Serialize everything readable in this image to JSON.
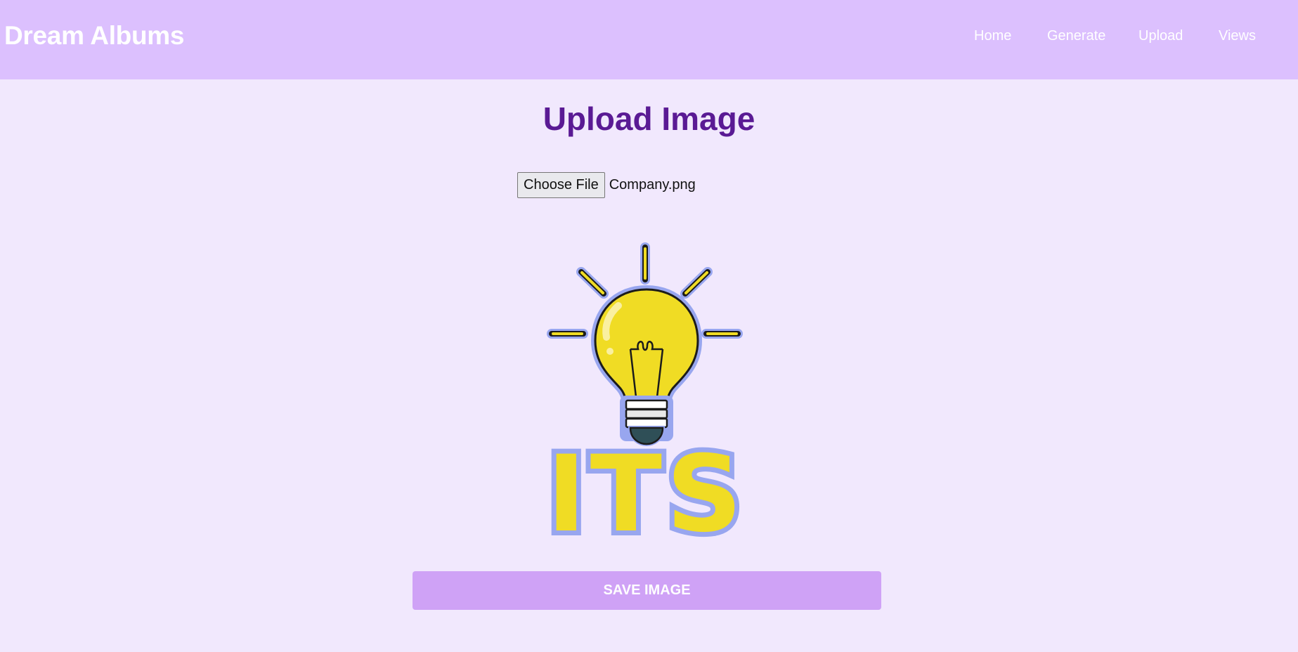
{
  "header": {
    "brand": "Dream Albums",
    "nav": [
      "Home",
      "Generate",
      "Upload",
      "Views"
    ]
  },
  "main": {
    "title": "Upload Image",
    "file_input": {
      "button_label": "Choose File",
      "file_name": "Company.png"
    },
    "preview": {
      "image_text": "ITS",
      "icon": "lightbulb-icon"
    },
    "save_button_label": "SAVE IMAGE"
  },
  "colors": {
    "navbar": "#dcc0fe",
    "page_background": "#f1e8fd",
    "title": "#5a1a94",
    "save_button": "#cfa2f6",
    "bulb_yellow": "#f0dc24",
    "outline_blue": "#98a6ef"
  }
}
